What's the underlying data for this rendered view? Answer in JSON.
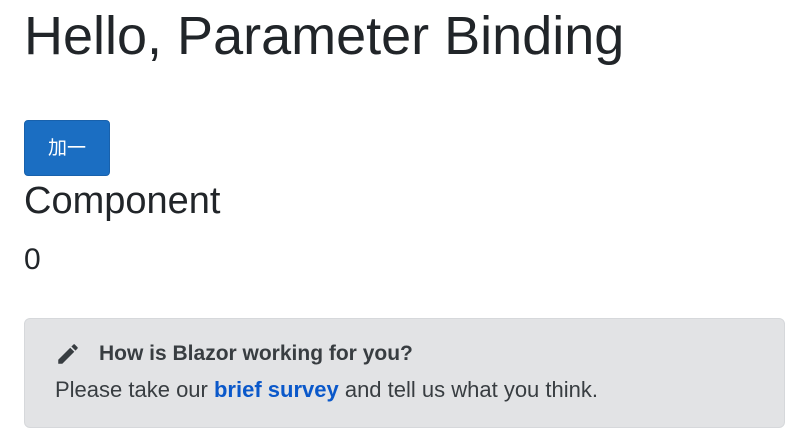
{
  "page": {
    "title": "Hello, Parameter Binding",
    "button_label": "加一",
    "component_heading": "Component",
    "counter_value": "0"
  },
  "survey": {
    "icon": "pencil-icon",
    "title": "How is Blazor working for you?",
    "text_before": "Please take our ",
    "link_text": "brief survey",
    "text_after": " and tell us what you think."
  },
  "colors": {
    "button_bg": "#1b6ec2",
    "survey_bg": "#e2e3e5",
    "link": "#0a58ca",
    "text": "#212529"
  }
}
